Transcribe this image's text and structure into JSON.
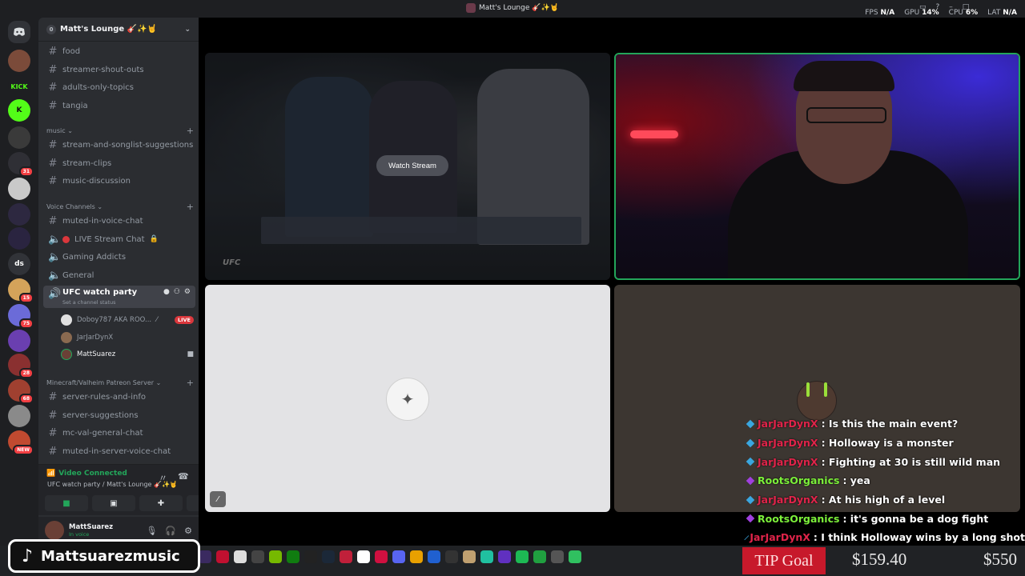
{
  "window": {
    "title": "Matt's Lounge 🎸✨🤘",
    "perf": [
      {
        "label": "FPS",
        "value": "N/A"
      },
      {
        "label": "GPU",
        "value": "14%"
      },
      {
        "label": "CPU",
        "value": "6%"
      },
      {
        "label": "LAT",
        "value": "N/A"
      }
    ]
  },
  "rail": {
    "home_icon": "discord-logo-icon",
    "servers": [
      {
        "label": "",
        "color": "#7b4b3a",
        "badge": ""
      },
      {
        "label": "KICK",
        "color": "#1e1f22",
        "badge": ""
      },
      {
        "label": "K",
        "color": "#53fc18",
        "badge": ""
      },
      {
        "label": "",
        "color": "#3a3a3a",
        "badge": ""
      },
      {
        "label": "",
        "color": "#2f2f35",
        "badge": "31"
      },
      {
        "label": "",
        "color": "#c9c9c9",
        "badge": ""
      },
      {
        "label": "",
        "color": "#2d2840",
        "badge": ""
      },
      {
        "label": "",
        "color": "#2a2440",
        "badge": ""
      },
      {
        "label": "ds",
        "color": "#313338",
        "badge": ""
      },
      {
        "label": "",
        "color": "#d4a35a",
        "badge": "15"
      },
      {
        "label": "",
        "color": "#6b6bd8",
        "badge": "75"
      },
      {
        "label": "",
        "color": "#6a3fb0",
        "badge": ""
      },
      {
        "label": "",
        "color": "#8a3030",
        "badge": "28"
      },
      {
        "label": "",
        "color": "#a04030",
        "badge": "68"
      },
      {
        "label": "",
        "color": "#8a8a8a",
        "badge": ""
      },
      {
        "label": "",
        "color": "#c04a30",
        "badge": "NEW"
      }
    ]
  },
  "guild": {
    "name": "Matt's Lounge 🎸✨🤘",
    "boost": "0"
  },
  "channels_top": [
    "food",
    "streamer-shout-outs",
    "adults-only-topics",
    "tangia"
  ],
  "categories": {
    "music": "music",
    "voice": "Voice Channels",
    "minecraft": "Minecraft/Valheim Patreon Server"
  },
  "music_channels": [
    "stream-and-songlist-suggestions",
    "stream-clips",
    "music-discussion"
  ],
  "voice_channels": [
    {
      "name": "muted-in-voice-chat",
      "type": "text"
    },
    {
      "name": "LIVE Stream Chat",
      "type": "voice"
    },
    {
      "name": "Gaming Addicts",
      "type": "voice"
    },
    {
      "name": "General",
      "type": "voice"
    }
  ],
  "active_channel": {
    "name": "UFC watch party",
    "status": "Set a channel status"
  },
  "voice_users": [
    {
      "name": "Doboy787 AKA ROO...",
      "live": "LIVE"
    },
    {
      "name": "JarJarDynX",
      "live": ""
    },
    {
      "name": "MattSuarez",
      "live": ""
    }
  ],
  "mc_channels": [
    "server-rules-and-info",
    "server-suggestions",
    "mc-val-general-chat",
    "muted-in-server-voice-chat"
  ],
  "voice_panel": {
    "status": "Video Connected",
    "location": "UFC watch party / Matt's Lounge 🎸✨🤘"
  },
  "user_panel": {
    "name": "MattSuarez",
    "status": "In voice"
  },
  "stage": {
    "watch_label": "Watch Stream",
    "ufc_label": "UFC"
  },
  "chat": [
    {
      "user": "JarJarDynX",
      "text": ": Is this the main event?",
      "color": "#e0244a",
      "badge": "#3aa7e0"
    },
    {
      "user": "JarJarDynX",
      "text": ": Holloway is a monster",
      "color": "#e0244a",
      "badge": "#3aa7e0"
    },
    {
      "user": "JarJarDynX",
      "text": ": Fighting at 30 is still wild man",
      "color": "#e0244a",
      "badge": "#3aa7e0"
    },
    {
      "user": "RootsOrganics",
      "text": ": yea",
      "color": "#7cf03a",
      "badge": "#a040e0"
    },
    {
      "user": "JarJarDynX",
      "text": ": At his high of a level",
      "color": "#e0244a",
      "badge": "#3aa7e0"
    },
    {
      "user": "RootsOrganics",
      "text": ": it's gonna be a dog fight",
      "color": "#7cf03a",
      "badge": "#a040e0"
    },
    {
      "user": "JarJarDynX",
      "text": ": I think Holloway wins by a long shot",
      "color": "#e0244a",
      "badge": "#3aa7e0"
    }
  ],
  "overlay": {
    "tiktok_handle": "Mattsuarezmusic",
    "tip_goal_label": "TIP Goal",
    "tip_current": "$159.40",
    "tip_target": "$550"
  },
  "taskbar": [
    {
      "icon": "obs-icon",
      "color": "#3a2a60"
    },
    {
      "icon": "power-icon",
      "color": "#c01030"
    },
    {
      "icon": "file-icon",
      "color": "#dddddd"
    },
    {
      "icon": "flex-icon",
      "color": "#444444"
    },
    {
      "icon": "nvidia-icon",
      "color": "#76b900"
    },
    {
      "icon": "xbox-icon",
      "color": "#107c10"
    },
    {
      "icon": "capcut-icon",
      "color": "#222222"
    },
    {
      "icon": "steam-icon",
      "color": "#1b2838"
    },
    {
      "icon": "app-red-icon",
      "color": "#c0203a"
    },
    {
      "icon": "app-ring-icon",
      "color": "#ffffff"
    },
    {
      "icon": "app-red2-icon",
      "color": "#d01040"
    },
    {
      "icon": "discord-icon",
      "color": "#5865f2"
    },
    {
      "icon": "chrome-icon",
      "color": "#e8a000"
    },
    {
      "icon": "app-blue-icon",
      "color": "#2060d0"
    },
    {
      "icon": "app-dark-icon",
      "color": "#333333"
    },
    {
      "icon": "app-tan-icon",
      "color": "#c0a070"
    },
    {
      "icon": "app-teal-icon",
      "color": "#20c0a0"
    },
    {
      "icon": "app-purple-icon",
      "color": "#6030c0"
    },
    {
      "icon": "spotify-icon",
      "color": "#1db954"
    },
    {
      "icon": "app-green-icon",
      "color": "#20a040"
    },
    {
      "icon": "app-gray-icon",
      "color": "#555555"
    },
    {
      "icon": "app-green2-icon",
      "color": "#30c060"
    }
  ]
}
